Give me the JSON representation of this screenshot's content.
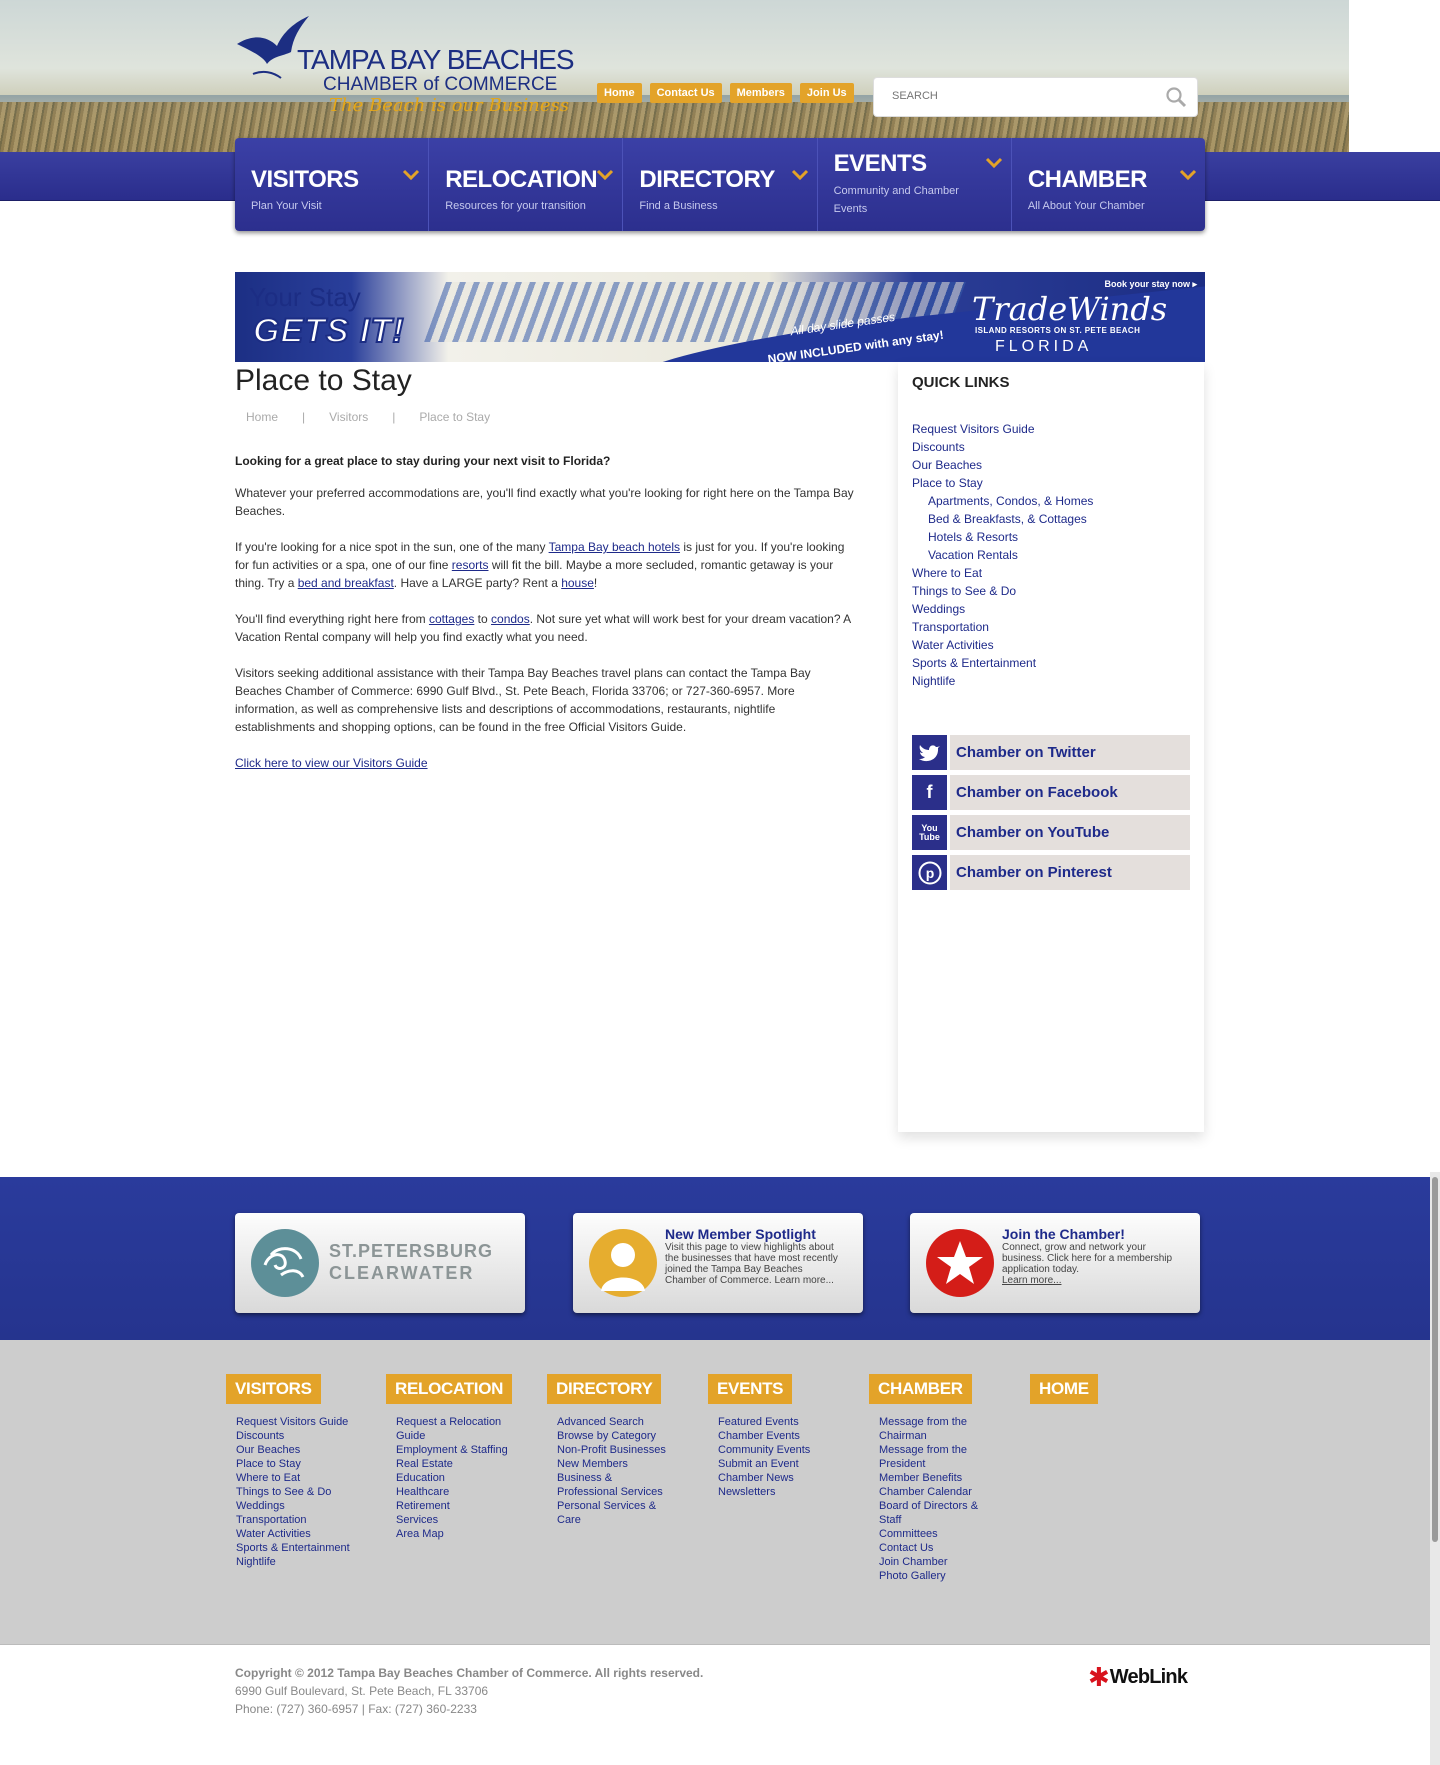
{
  "header": {
    "logo": {
      "line1": "TAMPA BAY BEACHES",
      "line2": "CHAMBER of COMMERCE",
      "tagline": "The Beach is our Business"
    },
    "top_buttons": [
      "Home",
      "Contact Us",
      "Members",
      "Join Us"
    ],
    "search_placeholder": "SEARCH"
  },
  "nav": [
    {
      "title": "VISITORS",
      "sub": "Plan Your Visit"
    },
    {
      "title": "RELOCATION",
      "sub": "Resources for your transition"
    },
    {
      "title": "DIRECTORY",
      "sub": "Find a Business"
    },
    {
      "title": "EVENTS",
      "sub": "Community and Chamber Events"
    },
    {
      "title": "CHAMBER",
      "sub": "All About Your Chamber"
    }
  ],
  "banner": {
    "line1": "Your Stay",
    "line2": "GETS IT!",
    "promo1": "All day slide passes",
    "promo2": "NOW INCLUDED with any stay!",
    "book": "Book your stay now ▸",
    "brand": "TradeWinds",
    "brand_sub": "ISLAND RESORTS ON ST. PETE BEACH",
    "brand_loc": "FLORIDA"
  },
  "content": {
    "title": "Place to Stay",
    "breadcrumb": [
      "Home",
      "Visitors",
      "Place to Stay"
    ],
    "lead": "Looking for a great place to stay during your next visit to Florida?",
    "p1": "Whatever your preferred accommodations are, you'll find exactly what you're looking for right here on the Tampa Bay Beaches.",
    "p2": {
      "a": "If you're looking for a nice spot in the sun, one of the many ",
      "link1": "Tampa Bay beach hotels",
      "b": " is just for you. If you're looking for fun activities or a spa, one of our fine ",
      "link2": "resorts",
      "c": " will fit the bill. Maybe a more secluded, romantic getaway is your thing. Try a ",
      "link3": "bed and breakfast",
      "d": ". Have a LARGE party? Rent a ",
      "link4": "house",
      "e": "!"
    },
    "p3": {
      "a": "You'll find everything right here from ",
      "link1": "cottages",
      "b": " to ",
      "link2": "condos",
      "c": ". Not sure yet what will work best for your dream vacation? A Vacation Rental company will help you find exactly what you need."
    },
    "p4": "Visitors seeking additional assistance with their Tampa Bay Beaches travel plans can contact the Tampa Bay Beaches Chamber of Commerce: 6990 Gulf Blvd., St. Pete Beach, Florida 33706; or 727-360-6957. More information, as well as comprehensive lists and descriptions of accommodations, restaurants, nightlife establishments and shopping options, can be found in the free Official Visitors Guide.",
    "guide_link": "Click here to view our Visitors Guide"
  },
  "sidebar": {
    "heading": "QUICK LINKS",
    "links": [
      {
        "label": "Request Visitors Guide",
        "sub": false
      },
      {
        "label": "Discounts",
        "sub": false
      },
      {
        "label": "Our Beaches",
        "sub": false
      },
      {
        "label": "Place to Stay",
        "sub": false
      },
      {
        "label": "Apartments, Condos, & Homes",
        "sub": true
      },
      {
        "label": "Bed & Breakfasts, & Cottages",
        "sub": true
      },
      {
        "label": "Hotels & Resorts",
        "sub": true
      },
      {
        "label": "Vacation Rentals",
        "sub": true
      },
      {
        "label": "Where to Eat",
        "sub": false
      },
      {
        "label": "Things to See & Do",
        "sub": false
      },
      {
        "label": "Weddings",
        "sub": false
      },
      {
        "label": "Transportation",
        "sub": false
      },
      {
        "label": "Water Activities",
        "sub": false
      },
      {
        "label": "Sports & Entertainment",
        "sub": false
      },
      {
        "label": "Nightlife",
        "sub": false
      }
    ],
    "social": [
      {
        "label": "Chamber on Twitter",
        "icon": "twitter-icon"
      },
      {
        "label": "Chamber on Facebook",
        "icon": "facebook-icon"
      },
      {
        "label": "Chamber on YouTube",
        "icon": "youtube-icon"
      },
      {
        "label": "Chamber on Pinterest",
        "icon": "pinterest-icon"
      }
    ]
  },
  "promos": {
    "stpete": {
      "line1": "ST.PETERSBURG",
      "line2": "CLEARWATER"
    },
    "spotlight": {
      "title": "New Member Spotlight",
      "desc": "Visit this page to view highlights about the businesses that have most recently joined the Tampa Bay Beaches Chamber of Commerce.",
      "more": "Learn more..."
    },
    "join": {
      "title": "Join the Chamber!",
      "desc": "Connect, grow and network your business. Click here for a membership application today.",
      "more": "Learn more..."
    }
  },
  "footer_columns": [
    {
      "head": "VISITORS",
      "links": [
        "Request Visitors Guide",
        "Discounts",
        "Our Beaches",
        "Place to Stay",
        "Where to Eat",
        "Things to See & Do",
        "Weddings",
        "Transportation",
        "Water Activities",
        "Sports & Entertainment",
        "Nightlife"
      ]
    },
    {
      "head": "RELOCATION",
      "links": [
        "Request a Relocation Guide",
        "Employment & Staffing",
        "Real Estate",
        "Education",
        "Healthcare",
        "Retirement",
        "Services",
        "Area Map"
      ]
    },
    {
      "head": "DIRECTORY",
      "links": [
        "Advanced Search",
        "Browse by Category",
        "Non-Profit Businesses",
        "New Members",
        "Business & Professional Services",
        "Personal Services & Care"
      ]
    },
    {
      "head": "EVENTS",
      "links": [
        "Featured Events",
        "Chamber Events",
        "Community Events",
        "Submit an Event",
        "Chamber News",
        "Newsletters"
      ]
    },
    {
      "head": "CHAMBER",
      "links": [
        "Message from the Chairman",
        "Message from the President",
        "Member Benefits",
        "Chamber Calendar",
        "Board of Directors & Staff",
        "Committees",
        "Contact Us",
        "Join Chamber",
        "Photo Gallery"
      ]
    },
    {
      "head": "HOME",
      "links": []
    }
  ],
  "bottom": {
    "copyright": "Copyright © 2012 Tampa Bay Beaches Chamber of Commerce.  All rights reserved.",
    "address": "6990 Gulf Boulevard, St. Pete Beach, FL 33706",
    "phone": "Phone: (727) 360-6957 | Fax: (727) 360-2233",
    "weblink": "WebLink"
  },
  "colors": {
    "brand_blue": "#2c2f8e",
    "accent_gold": "#e3a329",
    "link_blue": "#1e2a8a"
  }
}
